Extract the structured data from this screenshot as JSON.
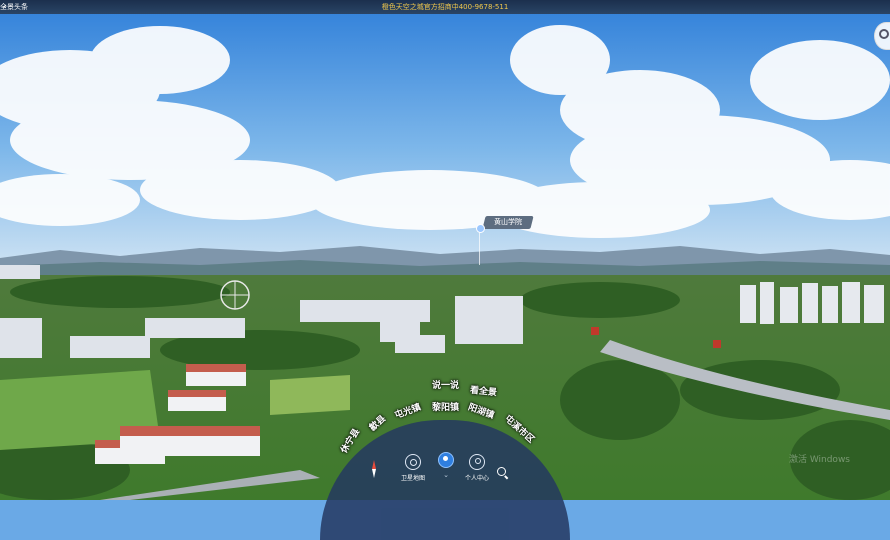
{
  "header": {
    "menu_icon": "back-arrow-icon",
    "left_label": "头条",
    "sub_label": "全景",
    "promo_text": "橙色天空之城官方招商中400-9678-511"
  },
  "hotspot": {
    "label": "黄山学院"
  },
  "signs": {
    "left_sign": "",
    "right_sign": ""
  },
  "arc_menu": {
    "items": [
      "休宁县",
      "歙县",
      "屯光镇",
      "黎阳镇",
      "说一说",
      "看全景",
      "阳湖镇",
      "屯溪市区"
    ]
  },
  "dock": {
    "compass_icon": "compass-icon",
    "items": [
      {
        "icon": "camera-icon",
        "label": "卫星地图"
      },
      {
        "icon": "map-pin-icon",
        "label": ""
      },
      {
        "icon": "user-icon",
        "label": "个人中心"
      },
      {
        "icon": "search-icon",
        "label": ""
      }
    ]
  },
  "watermark": "激活 Windows"
}
